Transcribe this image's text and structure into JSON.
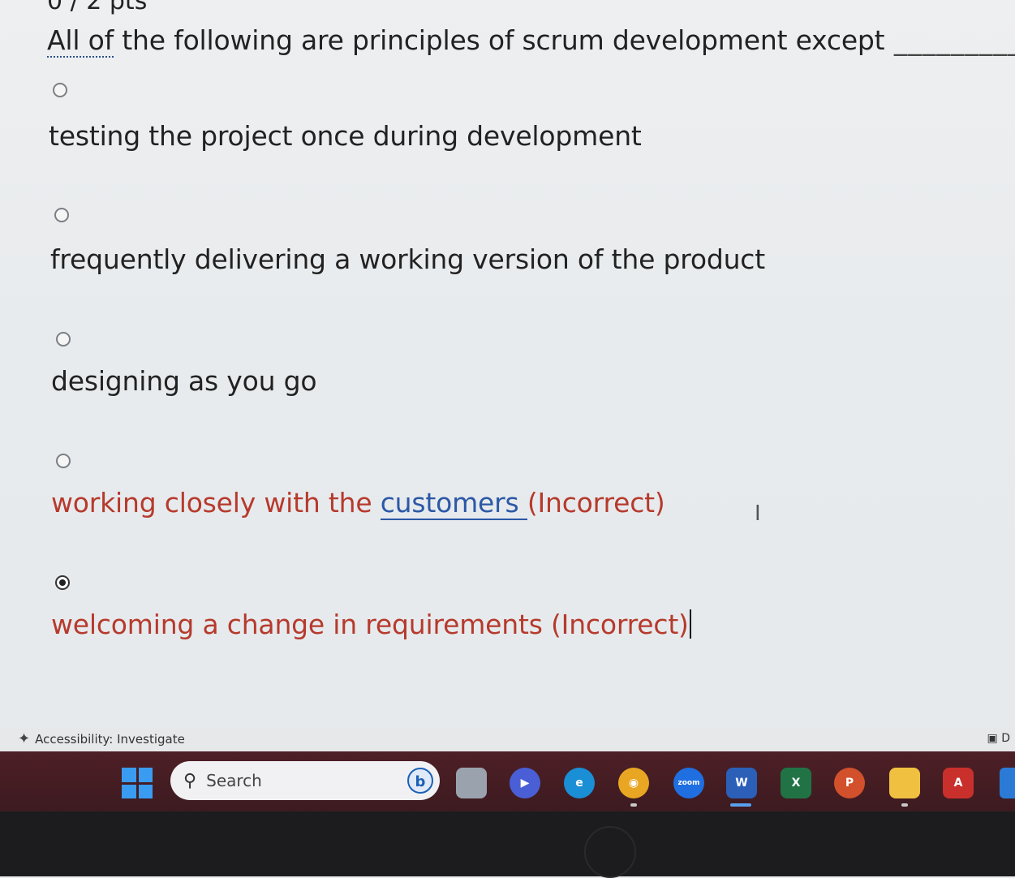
{
  "question": {
    "points": "0 / 2 pts",
    "text_prefix": "All of",
    "text_rest": " the following are principles of scrum development except",
    "blank": " _________."
  },
  "answers": [
    {
      "label": "testing the project once during development",
      "selected": false,
      "status": ""
    },
    {
      "label": "frequently delivering a working version of the product",
      "selected": false,
      "status": ""
    },
    {
      "label": "designing as you go",
      "selected": false,
      "status": ""
    },
    {
      "label_before": "working closely with the ",
      "label_link": "customers ",
      "label_after": "(Incorrect)",
      "selected": false
    },
    {
      "label": "welcoming a change in requirements (Incorrect)",
      "selected": true
    }
  ],
  "status_bar": {
    "accessibility": "Accessibility: Investigate",
    "right_text": "D"
  },
  "taskbar": {
    "search_placeholder": "Search",
    "bing_letter": "b",
    "apps": [
      {
        "name": "task-view",
        "icon": "task-view-icon"
      },
      {
        "name": "teams",
        "icon": "teams-icon",
        "color": "#4a5fd6"
      },
      {
        "name": "edge",
        "icon": "edge-icon",
        "color": "#1a8fd6"
      },
      {
        "name": "chrome",
        "icon": "chrome-icon",
        "color": "#e8a623"
      },
      {
        "name": "zoom",
        "icon": "zoom-icon",
        "color": "#1f6fe0",
        "label": "zoom"
      },
      {
        "name": "word",
        "icon": "word-icon",
        "color": "#2b5fb8",
        "label": "W"
      },
      {
        "name": "excel",
        "icon": "excel-icon",
        "color": "#217346",
        "label": "X"
      },
      {
        "name": "powerpoint",
        "icon": "powerpoint-icon",
        "color": "#d2502c",
        "label": "P"
      },
      {
        "name": "file-explorer",
        "icon": "folder-icon",
        "color": "#f0c040"
      },
      {
        "name": "acrobat",
        "icon": "acrobat-icon",
        "color": "#c9302c",
        "label": "A"
      }
    ]
  },
  "colors": {
    "incorrect": "#b63a2c",
    "link": "#2b58a6",
    "taskbar": "#4e1f26"
  }
}
